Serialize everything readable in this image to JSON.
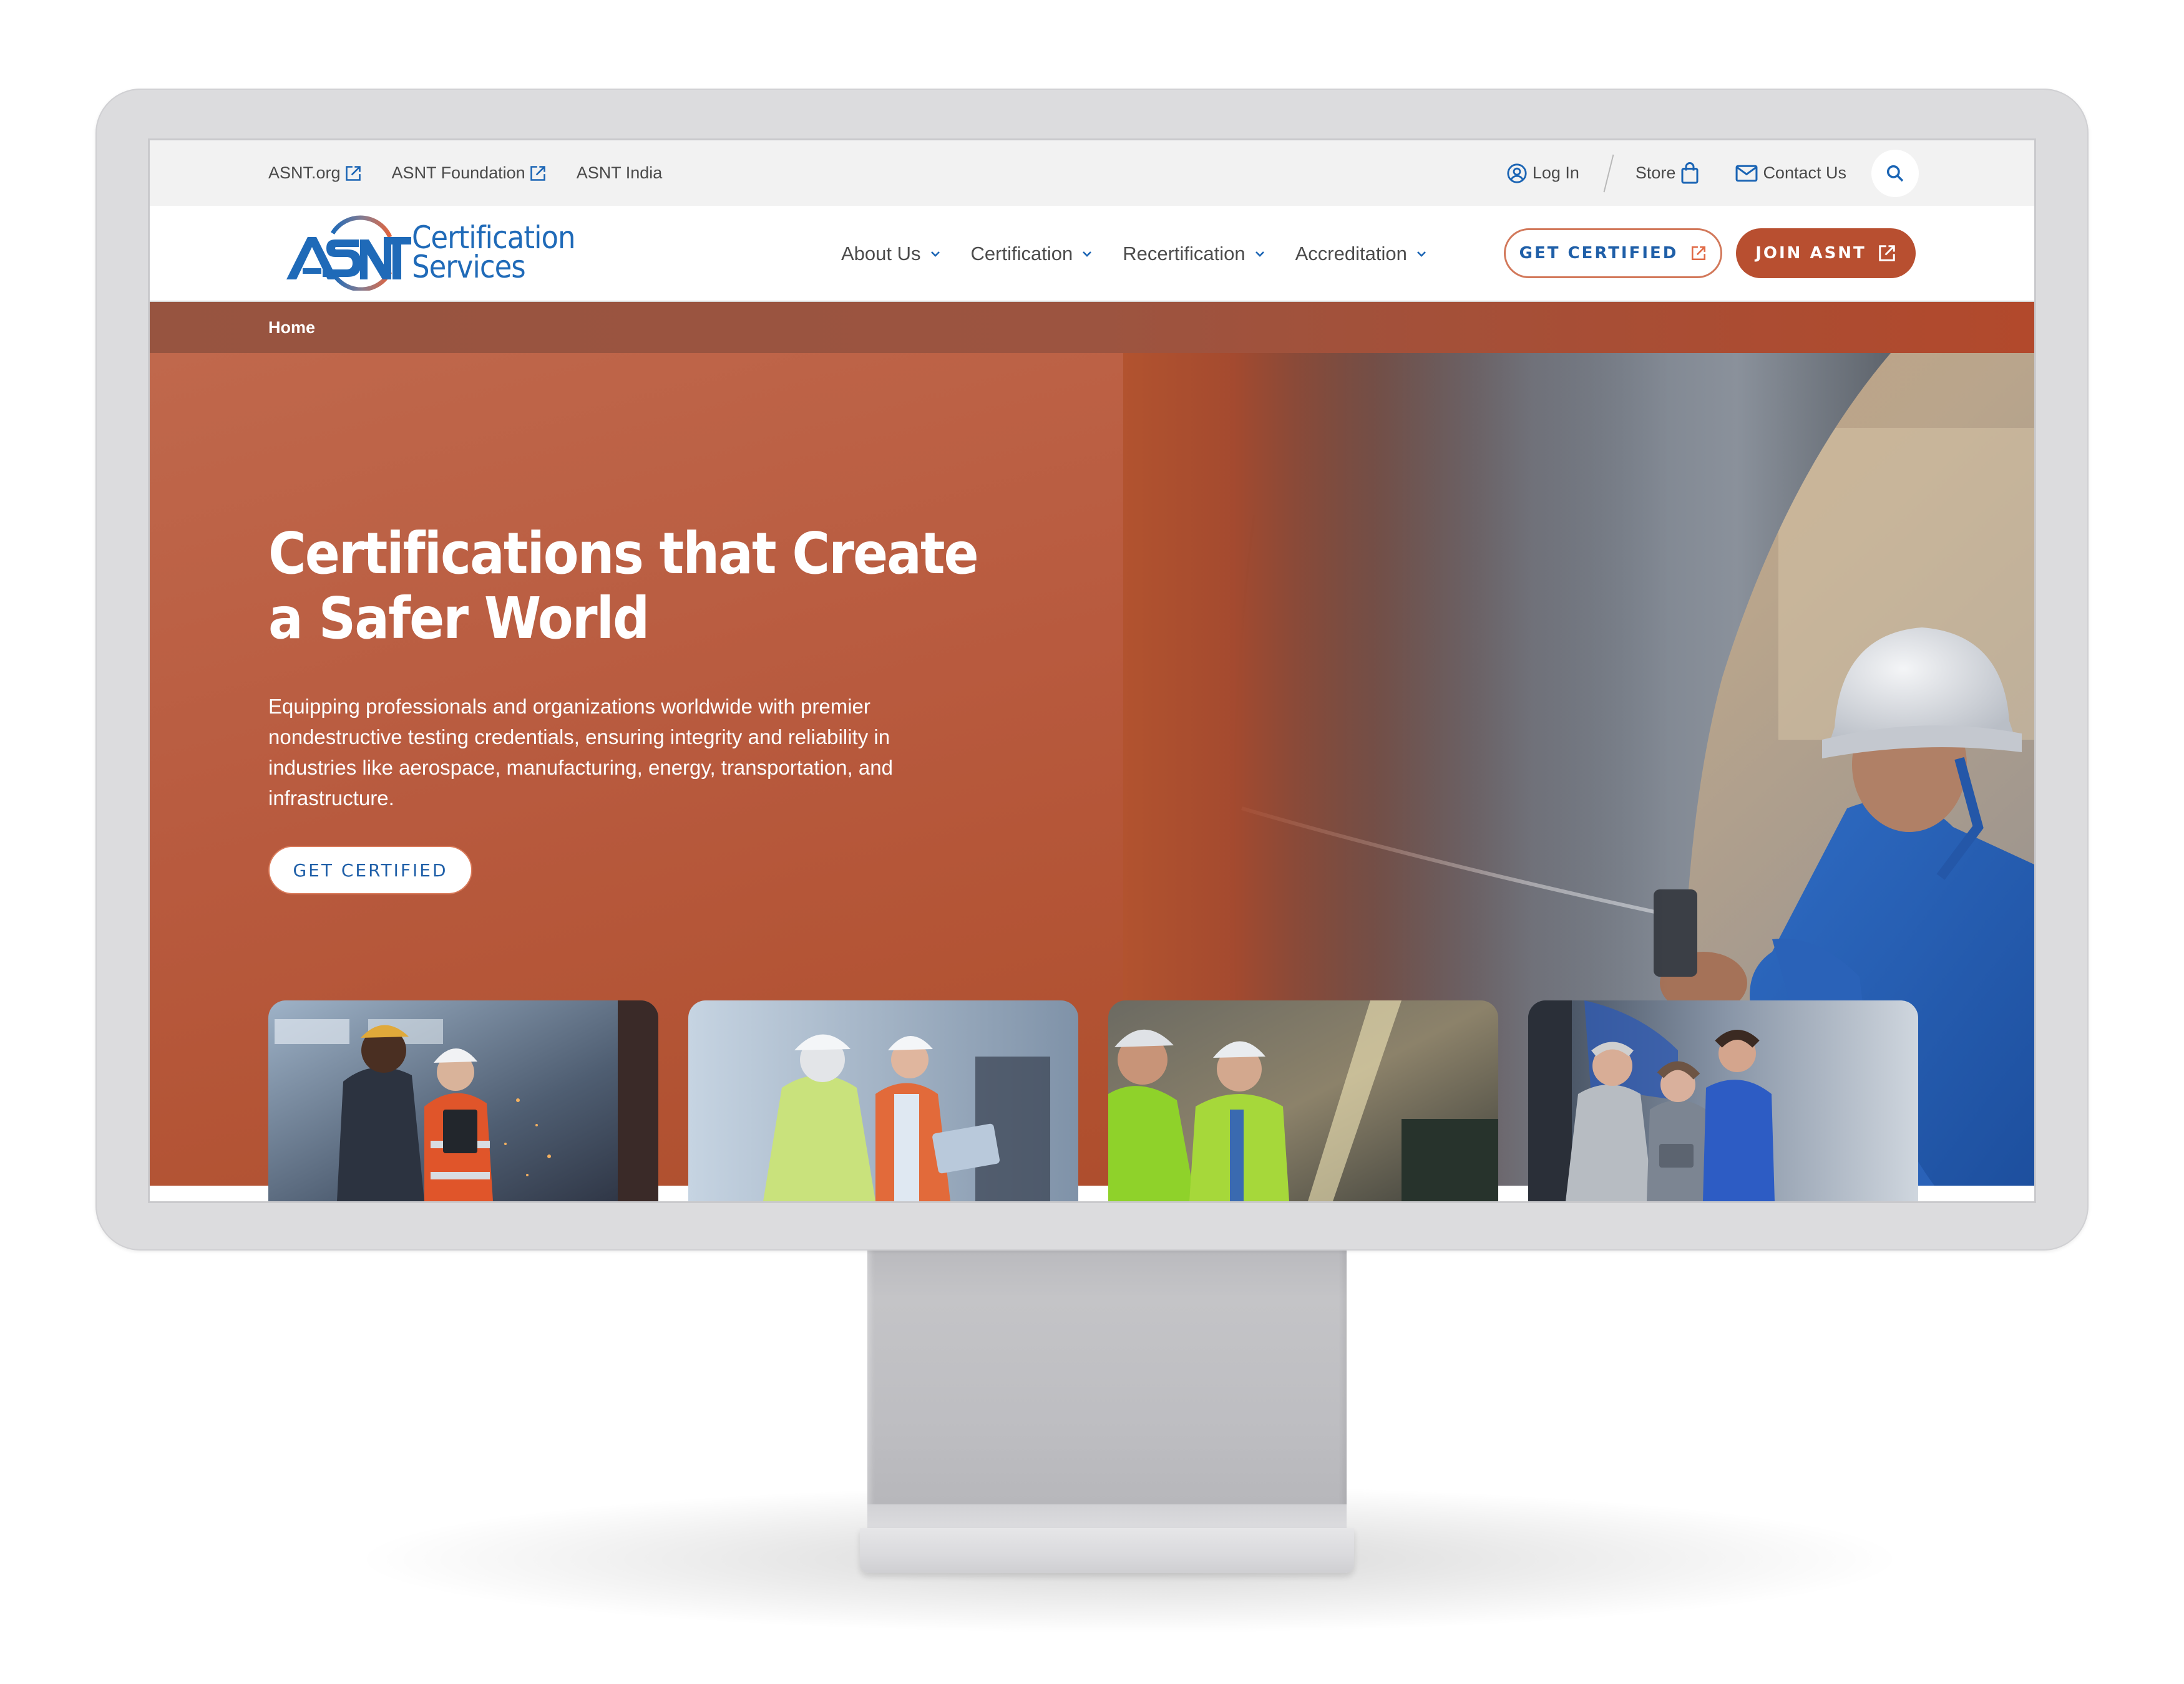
{
  "utility_bar": {
    "left_links": [
      {
        "label": "ASNT.org",
        "icon": "external-link-icon"
      },
      {
        "label": "ASNT Foundation",
        "icon": "external-link-icon"
      },
      {
        "label": "ASNT India",
        "icon": null
      }
    ],
    "login": {
      "label": "Log In",
      "icon": "user-circle-icon"
    },
    "store": {
      "label": "Store",
      "icon": "shopping-bag-icon"
    },
    "contact": {
      "label": "Contact Us",
      "icon": "mail-icon"
    },
    "search": {
      "icon": "search-icon"
    }
  },
  "header": {
    "logo": {
      "mark": "ASNT",
      "line1": "Certification",
      "line2": "Services"
    },
    "nav": [
      {
        "label": "About Us",
        "icon": "chevron-down-icon"
      },
      {
        "label": "Certification",
        "icon": "chevron-down-icon"
      },
      {
        "label": "Recertification",
        "icon": "chevron-down-icon"
      },
      {
        "label": "Accreditation",
        "icon": "chevron-down-icon"
      }
    ],
    "get_certified": {
      "label": "GET CERTIFIED",
      "icon": "external-link-icon"
    },
    "join": {
      "label": "JOIN ASNT",
      "icon": "external-link-icon"
    }
  },
  "breadcrumb": {
    "items": [
      "Home"
    ]
  },
  "hero": {
    "title": "Certifications that Create a Safer World",
    "body": "Equipping professionals and organizations worldwide with premier nondestructive testing credentials, ensuring integrity and reliability in industries like aerospace, manufacturing, energy, transportation, and infrastructure.",
    "cta_label": "GET CERTIFIED",
    "photo_alt": "Inspector in hard hat and blue coveralls examining a weld seam on a large steel pipe"
  },
  "cards": [
    {
      "alt": "Two workers in a steel factory reviewing a tablet amid grinding sparks"
    },
    {
      "alt": "Engineers in high-visibility vests discussing work with a laptop"
    },
    {
      "alt": "Two smiling workers in green safety jackets and hard hats looking at a screen"
    },
    {
      "alt": "Three technicians in a garage reviewing a tablet together"
    }
  ],
  "colors": {
    "brand_blue": "#1f6ab8",
    "brand_rust": "#b84f30",
    "hero_rust": "#b85a3e",
    "utility_bg": "#f2f2f2",
    "text_gray": "#4a4a4a"
  }
}
